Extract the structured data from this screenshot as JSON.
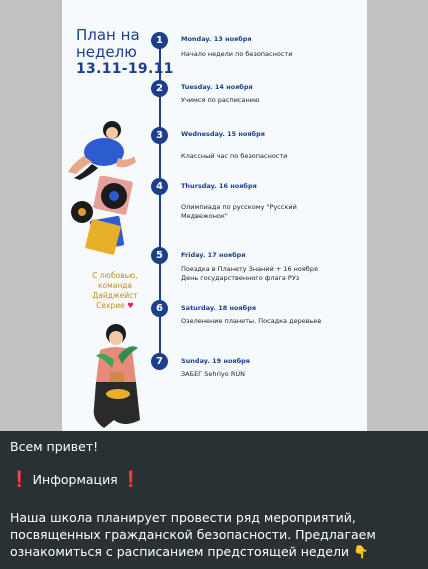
{
  "poster": {
    "title": "План на неделю",
    "dates": "13.11-19.11",
    "days": [
      {
        "number": "1",
        "title": "Monday. 13 ноября",
        "desc": "Начало недели по безопасности"
      },
      {
        "number": "2",
        "title": "Tuesday. 14 ноября",
        "desc": "Учимся по расписанию"
      },
      {
        "number": "3",
        "title": "Wednesday. 15 ноября",
        "desc": "Классный час по безопасности"
      },
      {
        "number": "4",
        "title": "Thursday. 16 ноября",
        "desc": "Олимпиада по русскому \"Русский Медвежонок\""
      },
      {
        "number": "5",
        "title": "Friday. 17 ноября",
        "desc": "Поездка в Планету Знаний + 16 ноября День государственного флага РУз"
      },
      {
        "number": "6",
        "title": "Saturday. 18 ноября",
        "desc": "Озеленение планеты. Посадка деревьев"
      },
      {
        "number": "7",
        "title": "Sunday. 19 ноября",
        "desc": "ЗАБЕГ Sehriyo RUN"
      }
    ],
    "signature": "С любовью, команда Дайджейст Сехрие",
    "signature_heart": "♥"
  },
  "message": {
    "greeting": "Всем привет!",
    "info_mark": "❗",
    "info_label": "Информация",
    "body_line1": "Наша школа планирует провести ряд мероприятий,",
    "body_line2": "посвященных гражданской безопасности. Предлагаем",
    "body_line3": "ознакомиться с расписанием предстоящей недели",
    "pointing_emoji": "👇"
  }
}
